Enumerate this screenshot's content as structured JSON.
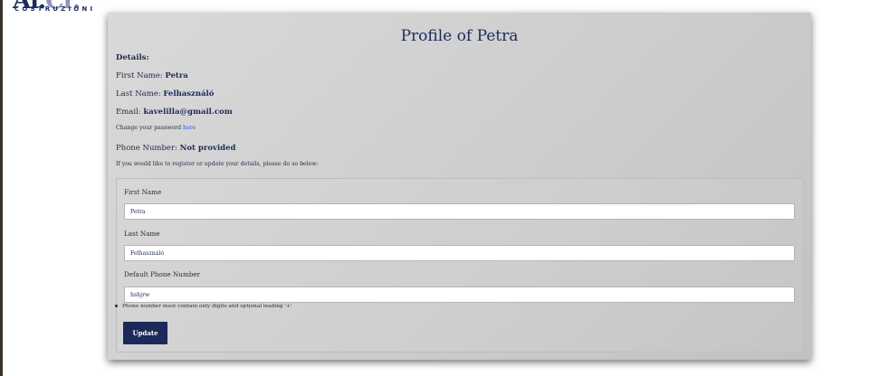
{
  "logo": {
    "mark_primary": "Al.",
    "mark_secondary": "Cr.",
    "subtitle": "COSTRUZIONI"
  },
  "profile": {
    "title": "Profile of Petra",
    "details_label": "Details:",
    "first_name_label": "First Name:",
    "first_name_value": "Petra",
    "last_name_label": "Last Name:",
    "last_name_value": "Felhasználó",
    "email_label": "Email:",
    "email_value": "kavelilla@gmail.com",
    "password_text": "Change your password",
    "password_link": "here",
    "phone_label": "Phone Number:",
    "phone_value": "Not provided",
    "intro": "If you would like to register or update your details, please do so below:"
  },
  "form": {
    "first_name_label": "First Name",
    "first_name_value": "Petra",
    "last_name_label": "Last Name",
    "last_name_value": "Felhasználó",
    "phone_label": "Default Phone Number",
    "phone_value": "hshjrw",
    "phone_hint": "Phone number must contain only digits and optional leading '+'",
    "update_label": "Update"
  },
  "colors": {
    "accent": "#1b2a5a",
    "link": "#2a5bd7",
    "card_bg": "#d0d0d0"
  }
}
